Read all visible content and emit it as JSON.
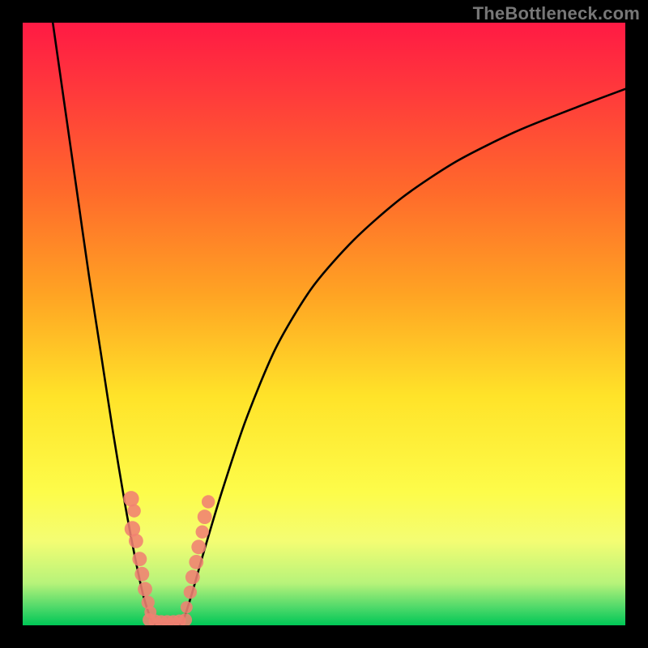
{
  "watermark": "TheBottleneck.com",
  "colors": {
    "frame": "#000000",
    "curve": "#000000",
    "marker_fill": "#f08172",
    "marker_stroke": "#f08172",
    "gradient_stops": [
      {
        "offset": 0.0,
        "color": "#ff1a44"
      },
      {
        "offset": 0.12,
        "color": "#ff3b3b"
      },
      {
        "offset": 0.28,
        "color": "#ff6a2b"
      },
      {
        "offset": 0.45,
        "color": "#ffa323"
      },
      {
        "offset": 0.62,
        "color": "#ffe329"
      },
      {
        "offset": 0.78,
        "color": "#fdfc4a"
      },
      {
        "offset": 0.86,
        "color": "#f4fd73"
      },
      {
        "offset": 0.93,
        "color": "#b7f37a"
      },
      {
        "offset": 0.97,
        "color": "#4fd96a"
      },
      {
        "offset": 1.0,
        "color": "#00c756"
      }
    ]
  },
  "chart_data": {
    "type": "line",
    "title": "",
    "xlabel": "",
    "ylabel": "",
    "xlim": [
      0,
      100
    ],
    "ylim": [
      0,
      100
    ],
    "grid": false,
    "legend": false,
    "note": "V-shaped bottleneck curve; values estimated from pixel positions (no axis ticks/labels in image).",
    "series": [
      {
        "name": "left-branch",
        "x": [
          5,
          7,
          9,
          11,
          13,
          15,
          17,
          18.5,
          20,
          21.5
        ],
        "y": [
          100,
          86,
          72,
          58,
          45,
          32,
          20,
          12,
          5,
          0.5
        ]
      },
      {
        "name": "floor",
        "x": [
          21.5,
          22.5,
          23.5,
          24.5,
          25.5,
          26.5
        ],
        "y": [
          0.5,
          0.4,
          0.3,
          0.3,
          0.4,
          0.5
        ]
      },
      {
        "name": "right-branch",
        "x": [
          26.5,
          28,
          30,
          33,
          37,
          42,
          48,
          55,
          63,
          72,
          82,
          92,
          100
        ],
        "y": [
          0.5,
          5,
          12,
          22,
          34,
          46,
          56,
          64,
          71,
          77,
          82,
          86,
          89
        ]
      }
    ],
    "markers": [
      {
        "x": 18.0,
        "y": 21,
        "r": 1.3
      },
      {
        "x": 18.5,
        "y": 19,
        "r": 1.1
      },
      {
        "x": 18.2,
        "y": 16,
        "r": 1.3
      },
      {
        "x": 18.8,
        "y": 14,
        "r": 1.2
      },
      {
        "x": 19.4,
        "y": 11,
        "r": 1.2
      },
      {
        "x": 19.8,
        "y": 8.5,
        "r": 1.2
      },
      {
        "x": 20.3,
        "y": 6.0,
        "r": 1.2
      },
      {
        "x": 20.8,
        "y": 3.8,
        "r": 1.1
      },
      {
        "x": 21.2,
        "y": 2.2,
        "r": 1.0
      },
      {
        "x": 21.0,
        "y": 0.9,
        "r": 1.1
      },
      {
        "x": 22.0,
        "y": 0.7,
        "r": 1.1
      },
      {
        "x": 23.0,
        "y": 0.6,
        "r": 1.1
      },
      {
        "x": 24.0,
        "y": 0.6,
        "r": 1.1
      },
      {
        "x": 25.0,
        "y": 0.6,
        "r": 1.1
      },
      {
        "x": 26.0,
        "y": 0.7,
        "r": 1.1
      },
      {
        "x": 27.0,
        "y": 0.9,
        "r": 1.1
      },
      {
        "x": 27.2,
        "y": 3.0,
        "r": 1.0
      },
      {
        "x": 27.8,
        "y": 5.5,
        "r": 1.1
      },
      {
        "x": 28.2,
        "y": 8.0,
        "r": 1.2
      },
      {
        "x": 28.8,
        "y": 10.5,
        "r": 1.2
      },
      {
        "x": 29.2,
        "y": 13.0,
        "r": 1.2
      },
      {
        "x": 29.8,
        "y": 15.5,
        "r": 1.1
      },
      {
        "x": 30.2,
        "y": 18.0,
        "r": 1.2
      },
      {
        "x": 30.8,
        "y": 20.5,
        "r": 1.1
      }
    ]
  }
}
